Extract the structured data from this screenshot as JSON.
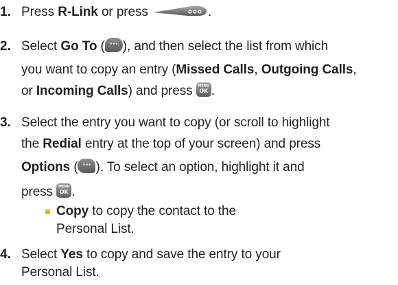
{
  "steps": [
    {
      "number": "1.",
      "lines": [
        {
          "parts": [
            "Press ",
            "R-Link",
            " or press "
          ],
          "tail": "."
        }
      ]
    },
    {
      "number": "2.",
      "lines": [
        {
          "a": "Select ",
          "b": "Go To",
          "c": " (",
          "d": "), and then select the list from which"
        },
        {
          "text": "you want to copy an entry ("
        },
        {
          "text": "or "
        },
        {
          "text": ") and press "
        }
      ]
    }
  ],
  "text": {
    "s1_press": "Press ",
    "s1_rlink": "R-Link",
    "s1_orpress": " or press ",
    "s1_end": ".",
    "s2_select": "Select ",
    "s2_goto": "Go To",
    "s2_open": " (",
    "s2_rest": "), and then select the list from which",
    "s2_l2a": "you want to copy an entry (",
    "s2_missed": "Missed Calls",
    "s2_comma1": ", ",
    "s2_outgoing": "Outgoing Calls",
    "s2_comma2": ",",
    "s2_l3a": "or ",
    "s2_incoming": "Incoming Calls",
    "s2_l3b": ") and press ",
    "s2_l3end": ".",
    "s3_l1": "Select the entry you want to copy (or scroll to highlight",
    "s3_l2a": "the ",
    "s3_redial": "Redial",
    "s3_l2b": " entry at the top of your screen) and press",
    "s3_options": "Options",
    "s3_l3a": " (",
    "s3_l3b": "). To select an option, highlight it and",
    "s3_l4": "press ",
    "s3_l4end": ".",
    "b_copy": "Copy",
    "b_l1": " to copy the contact to the",
    "b_l2": "Personal List.",
    "s4_select": "Select ",
    "s4_yes": "Yes",
    "s4_l1": " to copy and save the entry to your",
    "s4_l2": "Personal List.",
    "n1": "1.",
    "n2": "2.",
    "n3": "3.",
    "n4": "4.",
    "ok_top": "MENU",
    "ok_bottom": "OK",
    "softkey_glyph": "···"
  },
  "icons": {
    "nav_key": "nav-key-icon",
    "menu_ok_key": "menu-ok-key-icon",
    "left_softkey": "left-softkey-icon",
    "right_softkey": "right-softkey-icon"
  },
  "colors": {
    "text": "#231f20",
    "bullet": "#f2b21b",
    "key_gray": "#6e6e6e"
  }
}
